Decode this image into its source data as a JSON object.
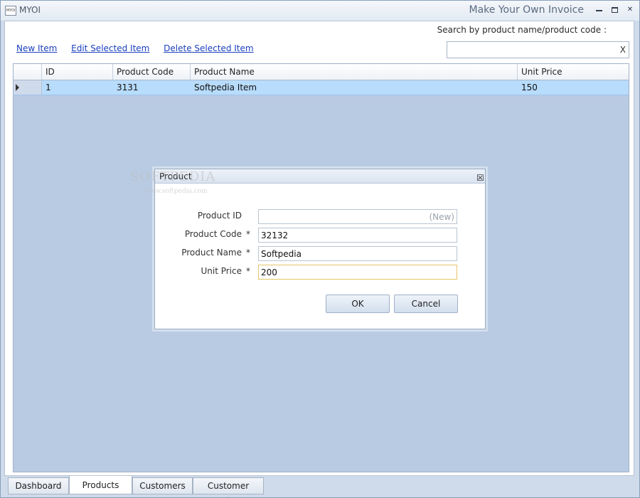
{
  "window": {
    "app_name": "MYOI",
    "app_icon_text": "MYOI",
    "title": "Make Your Own Invoice"
  },
  "search": {
    "label": "Search by product name/product code   :",
    "value": "",
    "clear_label": "X"
  },
  "actions": {
    "new_item": "New Item",
    "edit_item": "Edit Selected Item",
    "delete_item": "Delete Selected Item"
  },
  "grid": {
    "columns": [
      "ID",
      "Product Code",
      "Product Name",
      "Unit Price"
    ],
    "rows": [
      {
        "id": "1",
        "code": "3131",
        "name": "Softpedia Item",
        "price": "150"
      }
    ]
  },
  "dialog": {
    "title": "Product",
    "watermark": "SOFTPEDIA",
    "watermark_sub": "www.softpedia.com",
    "fields": {
      "product_id": {
        "label": "Product ID",
        "value": "(New)"
      },
      "product_code": {
        "label": "Product Code",
        "value": "32132",
        "required": "*"
      },
      "product_name": {
        "label": "Product Name",
        "value": "Softpedia",
        "required": "*"
      },
      "unit_price": {
        "label": "Unit Price",
        "value": "200",
        "required": "*"
      }
    },
    "ok_label": "OK",
    "cancel_label": "Cancel"
  },
  "tabs": [
    {
      "label": "Dashboard"
    },
    {
      "label": "Products",
      "active": true
    },
    {
      "label": "Customers"
    },
    {
      "label": "Customer Orders"
    }
  ],
  "colors": {
    "accent_link": "#1a3fbf",
    "selected_row": "#b8dcfb",
    "grid_background": "#b9cbe3",
    "focus_border": "#e4c46a"
  }
}
